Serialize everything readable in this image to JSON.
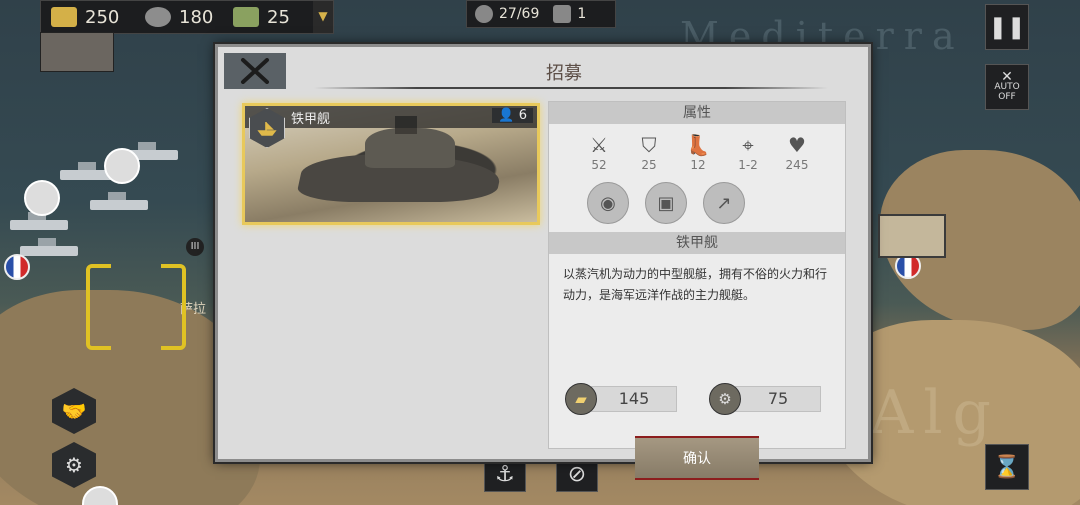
{
  "resources": {
    "gold": "250",
    "industry": "180",
    "food": "25"
  },
  "counters": {
    "units": "27/69",
    "cards": "1"
  },
  "hud": {
    "auto_label": "AUTO",
    "auto_state": "OFF",
    "pause_icon": "pause-icon",
    "hourglass_icon": "hourglass-icon"
  },
  "map": {
    "sea_label": "Mediterra",
    "region_label": "Alg",
    "town_label": "萨拉",
    "corps_number": "III"
  },
  "dialog": {
    "title": "招募",
    "unit": {
      "name": "铁甲舰",
      "population": "6"
    },
    "attributes_header": "属性",
    "stats": [
      {
        "icon": "attack-icon",
        "value": "52"
      },
      {
        "icon": "defense-icon",
        "value": "25"
      },
      {
        "icon": "movement-icon",
        "value": "12"
      },
      {
        "icon": "range-icon",
        "value": "1-2"
      },
      {
        "icon": "health-icon",
        "value": "245"
      }
    ],
    "traits": [
      "cannon-trait-icon",
      "armor-trait-icon",
      "artillery-upgrade-icon"
    ],
    "unit_header": "铁甲舰",
    "description": "以蒸汽机为动力的中型舰艇，拥有不俗的火力和行动力，是海军远洋作战的主力舰艇。",
    "cost": {
      "gold": "145",
      "industry": "75"
    },
    "confirm_label": "确认"
  },
  "colors": {
    "card_glow": "#e8c95b",
    "confirm_border": "#8c1d1d",
    "dialog_bg": "#dcdcdc"
  }
}
